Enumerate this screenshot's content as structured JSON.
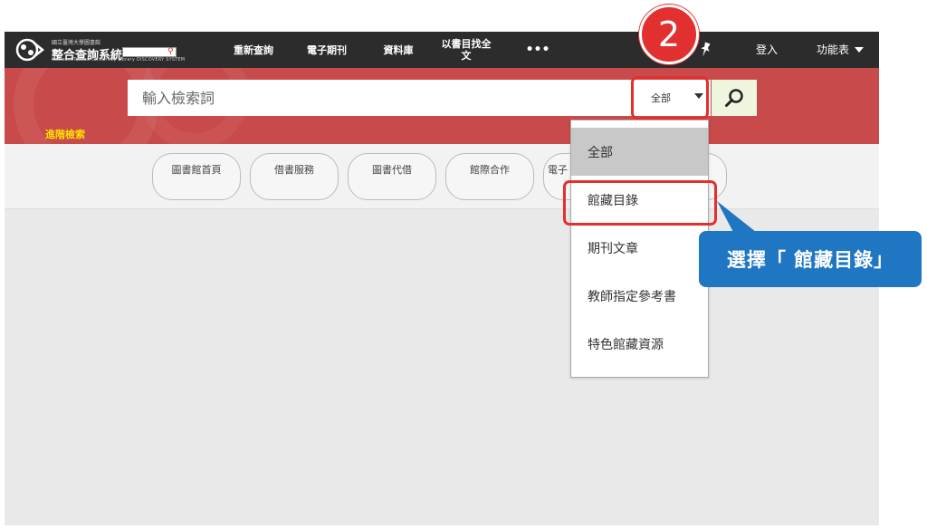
{
  "logo": {
    "small_text": "國立臺灣大學圖書館",
    "title": "整合查詢系統",
    "english": "National Taiwan University Library DISCOVERY SYSTEM"
  },
  "topnav": {
    "items": [
      "重新查詢",
      "電子期刊",
      "資料庫",
      "以書目找全文",
      "•••"
    ],
    "login": "登入",
    "menu": "功能表"
  },
  "search": {
    "placeholder": "輸入檢索詞",
    "scope_selected": "全部",
    "advanced": "進階檢索"
  },
  "shortcuts": [
    "圖書館首頁",
    "借書服務",
    "圖書代借",
    "館際合作",
    "電子"
  ],
  "dropdown": {
    "options": [
      "全部",
      "館藏目錄",
      "期刊文章",
      "教師指定參考書",
      "特色館藏資源"
    ],
    "highlighted_index": 0
  },
  "annotation": {
    "step": "2",
    "callout": "選擇「 館藏目錄」"
  },
  "colors": {
    "nav_bg": "#2c2c2c",
    "band_bg": "#c94a4a",
    "accent_red": "#e23030",
    "callout_blue": "#1f76c2",
    "advanced_yellow": "#ffe000"
  }
}
